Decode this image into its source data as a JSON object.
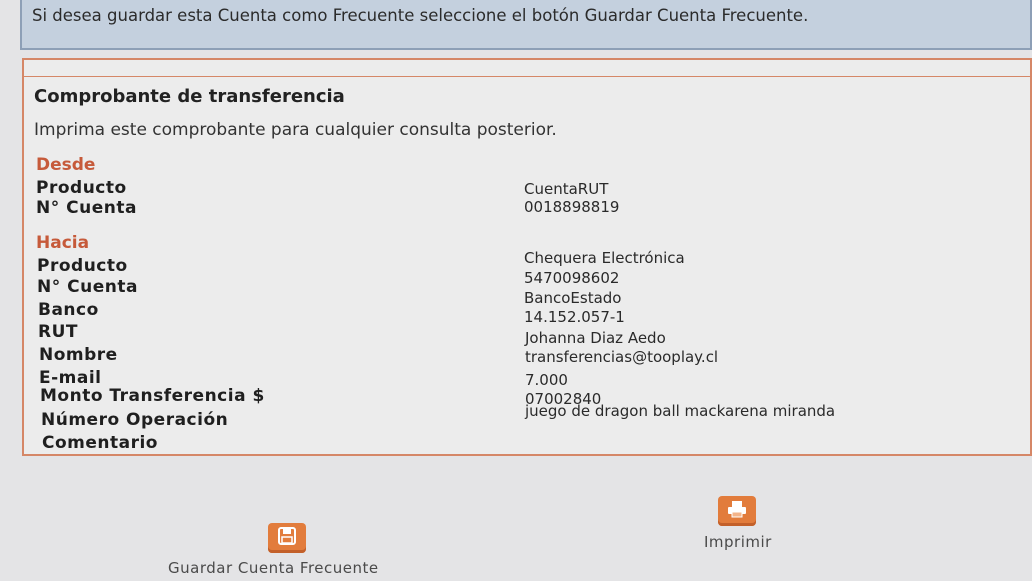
{
  "notice": {
    "text": "Si desea guardar esta Cuenta como Frecuente seleccione el botón Guardar Cuenta Frecuente."
  },
  "receipt": {
    "title": "Comprobante de transferencia",
    "subtitle": "Imprima este comprobante para cualquier consulta posterior.",
    "from": {
      "heading": "Desde",
      "rows": [
        {
          "label": "Producto",
          "value": "CuentaRUT"
        },
        {
          "label": "N° Cuenta",
          "value": "0018898819"
        }
      ]
    },
    "to": {
      "heading": "Hacia",
      "rows": [
        {
          "label": "Producto",
          "value": "Chequera Electrónica"
        },
        {
          "label": "N° Cuenta",
          "value": "5470098602"
        },
        {
          "label": "Banco",
          "value": "BancoEstado"
        },
        {
          "label": "RUT",
          "value": "14.152.057-1"
        },
        {
          "label": "Nombre",
          "value": "Johanna Diaz Aedo"
        },
        {
          "label": "E-mail",
          "value": "transferencias@tooplay.cl"
        },
        {
          "label": "Monto Transferencia $",
          "value": "7.000"
        },
        {
          "label": "Número Operación",
          "value": "07002840"
        },
        {
          "label": "Comentario",
          "value": "juego de dragon ball mackarena miranda"
        }
      ]
    }
  },
  "actions": {
    "save_label": "Guardar Cuenta Frecuente",
    "print_label": "Imprimir",
    "save_icon": "floppy-disk-icon",
    "print_icon": "printer-icon"
  },
  "colors": {
    "accent": "#e27c3c",
    "section_heading": "#c65a3a",
    "border": "#d58767",
    "notice_bg": "#c4d0de"
  }
}
